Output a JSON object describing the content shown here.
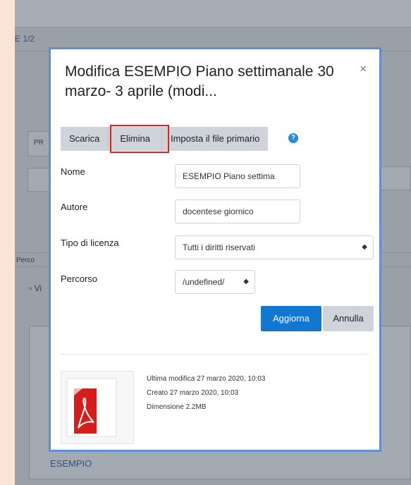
{
  "background": {
    "crumb": "E 1/2",
    "pr_label": "PR",
    "percorso_label": "Perco",
    "vi_label": "Vi",
    "esempio_link": "ESEMPIO"
  },
  "modal": {
    "title": "Modifica ESEMPIO Piano settimanale 30 marzo- 3 aprile (modi...",
    "close_icon": "×",
    "buttons": {
      "scarica": "Scarica",
      "elimina": "Elimina",
      "imposta": "Imposta il file primario"
    },
    "help_icon": "?",
    "form": {
      "nome_label": "Nome",
      "nome_value": "ESEMPIO Piano settima",
      "autore_label": "Autore",
      "autore_value": "docentese giornico",
      "licenza_label": "Tipo di licenza",
      "licenza_value": "Tutti i diritti riservati",
      "percorso_label": "Percorso",
      "percorso_value": "/undefined/"
    },
    "actions": {
      "aggiorna": "Aggiorna",
      "annulla": "Annulla"
    },
    "file_info": {
      "ultima_modifica": "Ultima modifica  27 marzo 2020, 10:03",
      "creato": "Creato  27 marzo 2020, 10:03",
      "dimensione": "Dimensione  2.2MB"
    }
  },
  "colors": {
    "primary": "#1177d1",
    "highlight": "#e0201b",
    "modal_border": "#5d8fd6"
  }
}
